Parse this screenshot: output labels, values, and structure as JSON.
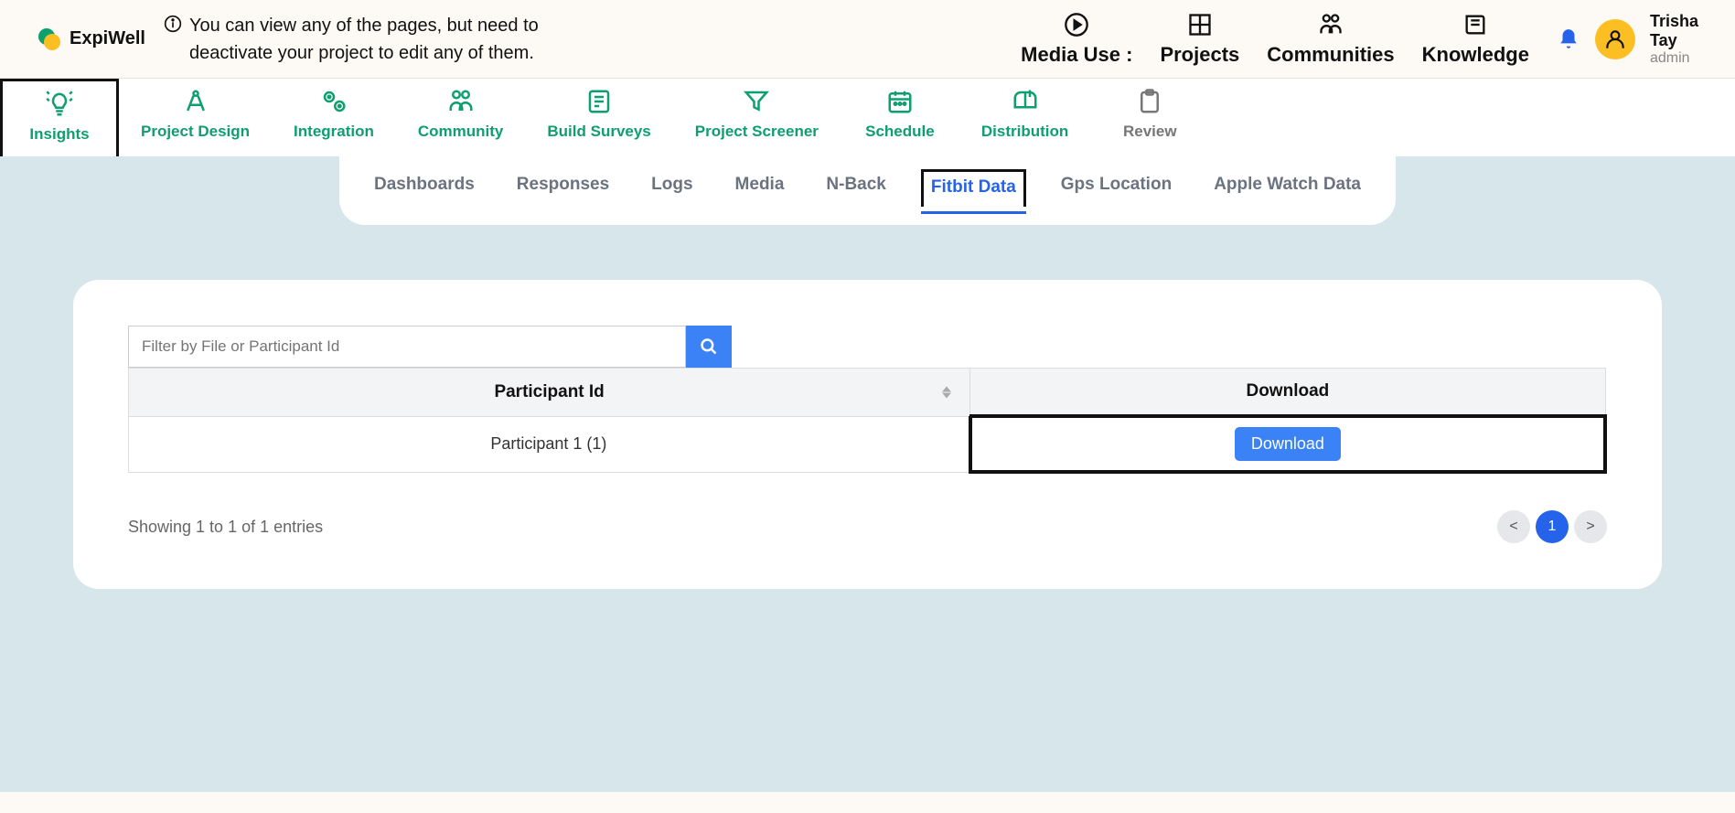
{
  "brand": "ExpiWell",
  "info_message": "You can view any of the pages, but need to deactivate your project to edit any of them.",
  "top_nav": {
    "media": "Media Use :",
    "projects": "Projects",
    "communities": "Communities",
    "knowledge": "Knowledge"
  },
  "user": {
    "name_line1": "Trisha",
    "name_line2": "Tay",
    "role": "admin"
  },
  "project_tabs": {
    "insights": "Insights",
    "project_design": "Project Design",
    "integration": "Integration",
    "community": "Community",
    "build_surveys": "Build Surveys",
    "project_screener": "Project Screener",
    "schedule": "Schedule",
    "distribution": "Distribution",
    "review": "Review"
  },
  "sub_tabs": {
    "dashboards": "Dashboards",
    "responses": "Responses",
    "logs": "Logs",
    "media": "Media",
    "nback": "N-Back",
    "fitbit": "Fitbit Data",
    "gps": "Gps Location",
    "apple": "Apple Watch Data"
  },
  "filter": {
    "placeholder": "Filter by File or Participant Id"
  },
  "table": {
    "col_participant": "Participant Id",
    "col_download": "Download",
    "rows": [
      {
        "participant": "Participant 1 (1)",
        "download_label": "Download"
      }
    ]
  },
  "footer": {
    "entries": "Showing 1 to 1 of 1 entries",
    "prev": "<",
    "page1": "1",
    "next": ">"
  }
}
